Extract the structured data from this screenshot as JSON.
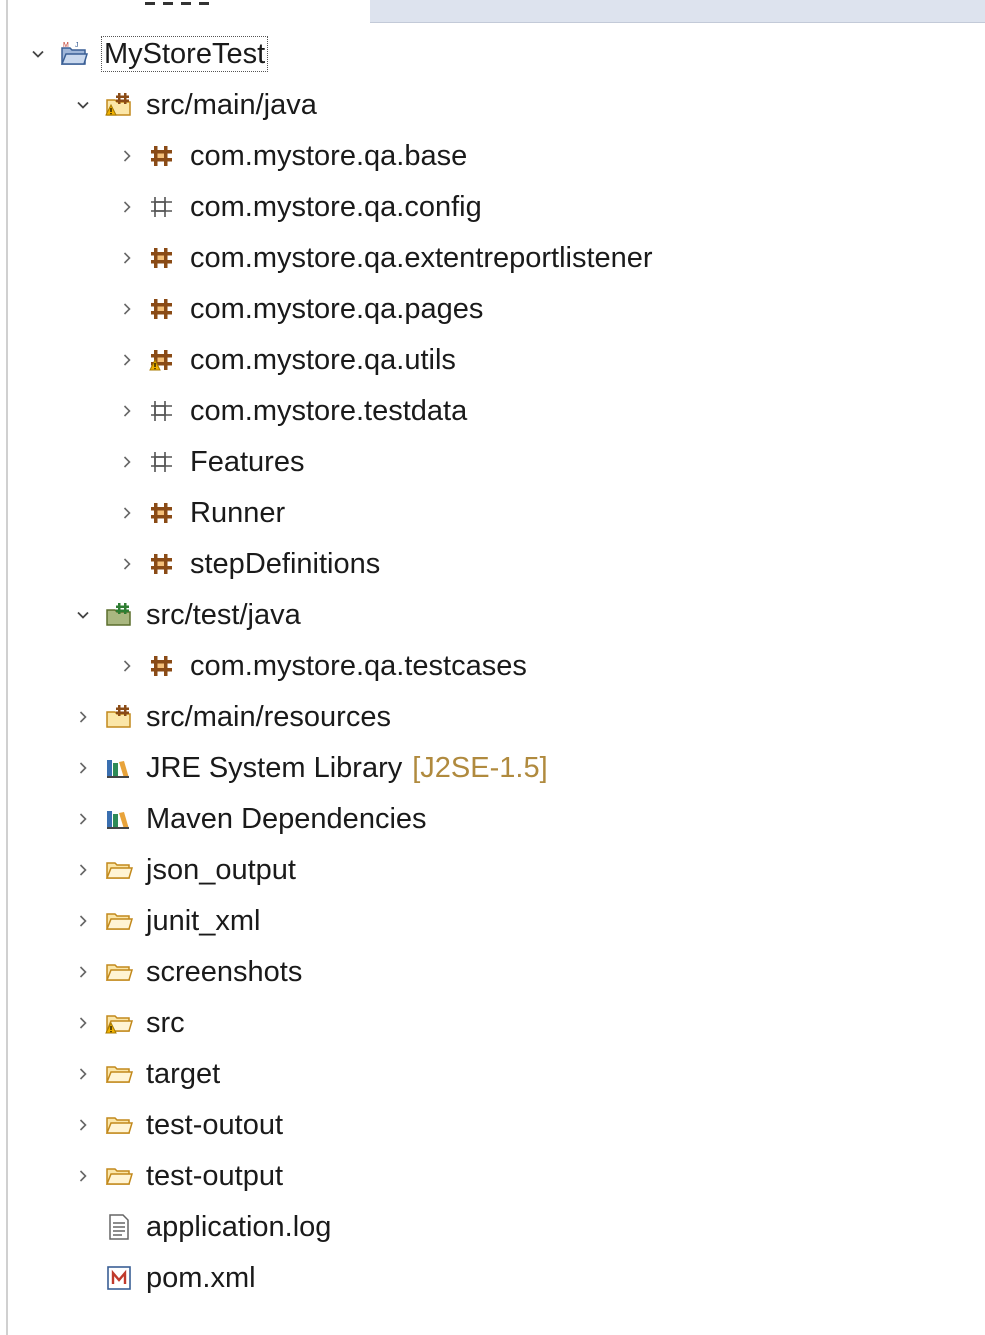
{
  "tree": {
    "project": {
      "label": "MyStoreTest",
      "icon": "project-icon",
      "expanded": true
    },
    "src_main_java": {
      "label": "src/main/java",
      "icon": "source-folder-icon",
      "expanded": true,
      "packages": [
        {
          "label": "com.mystore.qa.base",
          "icon": "package-icon"
        },
        {
          "label": "com.mystore.qa.config",
          "icon": "empty-package-icon"
        },
        {
          "label": "com.mystore.qa.extentreportlistener",
          "icon": "package-icon"
        },
        {
          "label": "com.mystore.qa.pages",
          "icon": "package-icon"
        },
        {
          "label": "com.mystore.qa.utils",
          "icon": "package-warning-icon"
        },
        {
          "label": "com.mystore.testdata",
          "icon": "empty-package-icon"
        },
        {
          "label": "Features",
          "icon": "empty-package-icon"
        },
        {
          "label": "Runner",
          "icon": "package-icon"
        },
        {
          "label": "stepDefinitions",
          "icon": "package-icon"
        }
      ]
    },
    "src_test_java": {
      "label": "src/test/java",
      "icon": "test-source-folder-icon",
      "expanded": true,
      "packages": [
        {
          "label": "com.mystore.qa.testcases",
          "icon": "package-icon"
        }
      ]
    },
    "others": [
      {
        "label": "src/main/resources",
        "icon": "source-folder-icon"
      },
      {
        "label": "JRE System Library",
        "decoration": "[J2SE-1.5]",
        "icon": "library-icon"
      },
      {
        "label": "Maven Dependencies",
        "icon": "library-icon"
      },
      {
        "label": "json_output",
        "icon": "folder-icon"
      },
      {
        "label": "junit_xml",
        "icon": "folder-icon"
      },
      {
        "label": "screenshots",
        "icon": "folder-icon"
      },
      {
        "label": "src",
        "icon": "folder-warning-icon"
      },
      {
        "label": "target",
        "icon": "folder-icon"
      },
      {
        "label": "test-outout",
        "icon": "folder-icon"
      },
      {
        "label": "test-output",
        "icon": "folder-icon"
      }
    ],
    "files": [
      {
        "label": "application.log",
        "icon": "text-file-icon"
      },
      {
        "label": "pom.xml",
        "icon": "maven-pom-icon"
      }
    ]
  },
  "colors": {
    "package": "#8a4b16",
    "folder": "#e0a830",
    "warning": "#f2b200",
    "decoration": "#b08a3e"
  }
}
